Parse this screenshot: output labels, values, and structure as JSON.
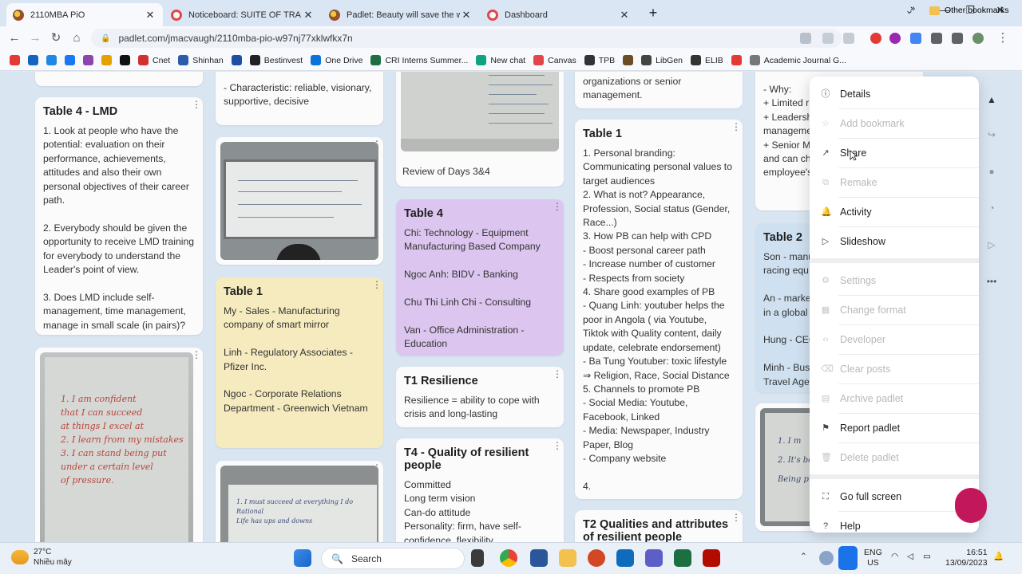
{
  "browser": {
    "tabs": [
      {
        "title": "2110MBA PiO",
        "active": true,
        "favicon": "padlet-icon"
      },
      {
        "title": "Noticeboard: SUITE OF TRAINING",
        "active": false,
        "favicon": "padlet-red-icon"
      },
      {
        "title": "Padlet: Beauty will save the work",
        "active": false,
        "favicon": "padlet-icon"
      },
      {
        "title": "Dashboard",
        "active": false,
        "favicon": "padlet-red-icon"
      }
    ],
    "url": "padlet.com/jmacvaugh/2110mba-pio-w97nj77xklwfkx7n",
    "bookmarks": [
      {
        "label": "",
        "color": "#e53935"
      },
      {
        "label": "",
        "color": "#1565c0"
      },
      {
        "label": "",
        "color": "#1e88e5"
      },
      {
        "label": "",
        "color": "#1877f2"
      },
      {
        "label": "",
        "color": "#8e44ad"
      },
      {
        "label": "",
        "color": "#e5a100"
      },
      {
        "label": "",
        "color": "#111111"
      },
      {
        "label": "Cnet",
        "color": "#d32f2f"
      },
      {
        "label": "Shinhan",
        "color": "#2a5caa"
      },
      {
        "label": "",
        "color": "#1e4fa3"
      },
      {
        "label": "Bestinvest",
        "color": "#222222"
      },
      {
        "label": "One Drive",
        "color": "#0a74da"
      },
      {
        "label": "CRI Interns Summer...",
        "color": "#1d6f42"
      },
      {
        "label": "New chat",
        "color": "#10a37f"
      },
      {
        "label": "Canvas",
        "color": "#e2464a"
      },
      {
        "label": "TPB",
        "color": "#333333"
      },
      {
        "label": "",
        "color": "#6a4e23"
      },
      {
        "label": "LibGen",
        "color": "#444444"
      },
      {
        "label": "ELIB",
        "color": "#333333"
      },
      {
        "label": "",
        "color": "#e53935"
      },
      {
        "label": "Academic Journal G...",
        "color": "#777777"
      }
    ],
    "other_bookmarks": "Other bookmarks"
  },
  "board": {
    "col1": [
      {
        "title": "Table 4 - LMD",
        "body": "1. Look at people who have the potential: evaluation on their performance, achievements, attitudes and also their own personal objectives of their career path.\n\n2. Everybody should be given the opportunity to receive LMD training for everybody to understand the Leader's point of view.\n\n3. Does LMD include self-management, time management, manage in small scale (in pairs)?"
      }
    ],
    "col2": {
      "top_text": "- Characteristic: reliable, visionary, supportive, decisive",
      "table1_title": "Table 1",
      "table1_body": "My - Sales - Manufacturing company of smart mirror\n\nLinh - Regulatory Associates - Pfizer Inc.\n\nNgoc - Corporate Relations Department - Greenwich Vietnam"
    },
    "col3": {
      "caption": "Review of Days 3&4",
      "table4_title": "Table 4",
      "table4_body": "Chi: Technology - Equipment Manufacturing Based Company\n\nNgoc Anh: BIDV - Banking\n\nChu Thi Linh Chi - Consulting\n\nVan - Office Administration - Education",
      "t1_title": "T1 Resilience",
      "t1_body": "Resilience = ability to cope with crisis and long-lasting",
      "t4_title": "T4 - Quality of resilient people",
      "t4_body": "Committed\nLong term vision\nCan-do attitude\nPersonality: firm, have self-confidence, flexibility"
    },
    "col4": {
      "top_text": "organizations or senior management.",
      "table1_title": "Table 1",
      "table1_body": "1. Personal branding: Communicating personal values to target audiences\n2. What is not? Appearance, Profession, Social status (Gender, Race...)\n3. How PB can help with CPD\n- Boost personal career path\n- Increase number of customer\n- Respects from society\n4. Share good examples of PB\n- Quang Linh: youtuber helps the poor in Angola ( via Youtube, Tiktok with Quality content, daily update, celebrate endorsement)\n- Ba Tung Youtuber: toxic lifestyle\n⇒ Religion, Race, Social Distance\n5. Channels to promote PB\n- Social Media: Youtube, Facebook, Linked\n- Media: Newspaper, Industry Paper, Blog\n- Company website\n\n4.",
      "t2_title": "T2 Qualities and attributes of resilient people"
    },
    "col5": {
      "top_text": "- Why:\n+ Limited r\n+ Leadersh\nmanageme\n+ Senior M\nand can ch\nemployee's",
      "table2_title": "Table 2",
      "table2_body": "Son - manu\nracing equ\n\nAn - marke\nin a global\n\nHung - CEO\n\nMinh - Bus\nTravel Agen"
    },
    "photo_texts": {
      "photo1": [
        "1. I am confident",
        "that I can succeed",
        "at things I excel at",
        "2. I learn from my mistakes",
        "3. I can stand being put",
        "under a certain level",
        "of pressure."
      ],
      "photo2": [
        "1. I must succeed at everything I do",
        "Rational",
        "Life has ups and downs"
      ],
      "photo3": [
        "1. I m",
        "2. It's bo",
        "Being put"
      ]
    }
  },
  "menu": {
    "items": [
      {
        "label": "Details",
        "icon": "info-icon",
        "disabled": false
      },
      {
        "label": "Add bookmark",
        "icon": "star-icon",
        "disabled": true
      },
      {
        "label": "Share",
        "icon": "share-arrow-icon",
        "disabled": false
      },
      {
        "label": "Remake",
        "icon": "remake-icon",
        "disabled": true
      },
      {
        "label": "Activity",
        "icon": "bell-icon",
        "disabled": false
      },
      {
        "label": "Slideshow",
        "icon": "play-icon",
        "disabled": false
      },
      {
        "label": "Settings",
        "icon": "gear-icon",
        "disabled": true
      },
      {
        "label": "Change format",
        "icon": "format-icon",
        "disabled": true
      },
      {
        "label": "Developer",
        "icon": "code-icon",
        "disabled": true
      },
      {
        "label": "Clear posts",
        "icon": "eraser-icon",
        "disabled": true
      },
      {
        "label": "Archive padlet",
        "icon": "archive-icon",
        "disabled": true
      },
      {
        "label": "Report padlet",
        "icon": "flag-icon",
        "disabled": false
      },
      {
        "label": "Delete padlet",
        "icon": "trash-icon",
        "disabled": true
      },
      {
        "label": "Go full screen",
        "icon": "fullscreen-icon",
        "disabled": false
      },
      {
        "label": "Help",
        "icon": "help-icon",
        "disabled": false
      }
    ]
  },
  "taskbar": {
    "temp": "27°C",
    "weather": "Nhiều mây",
    "search": "Search",
    "lang1": "ENG",
    "lang2": "US",
    "time": "16:51",
    "date": "13/09/2023"
  },
  "colors": {
    "board_bg": "#d9e6f2",
    "card_yellow": "#f5ebbe",
    "card_purple": "#dcc5ee",
    "accent_pink": "#c2185b"
  }
}
